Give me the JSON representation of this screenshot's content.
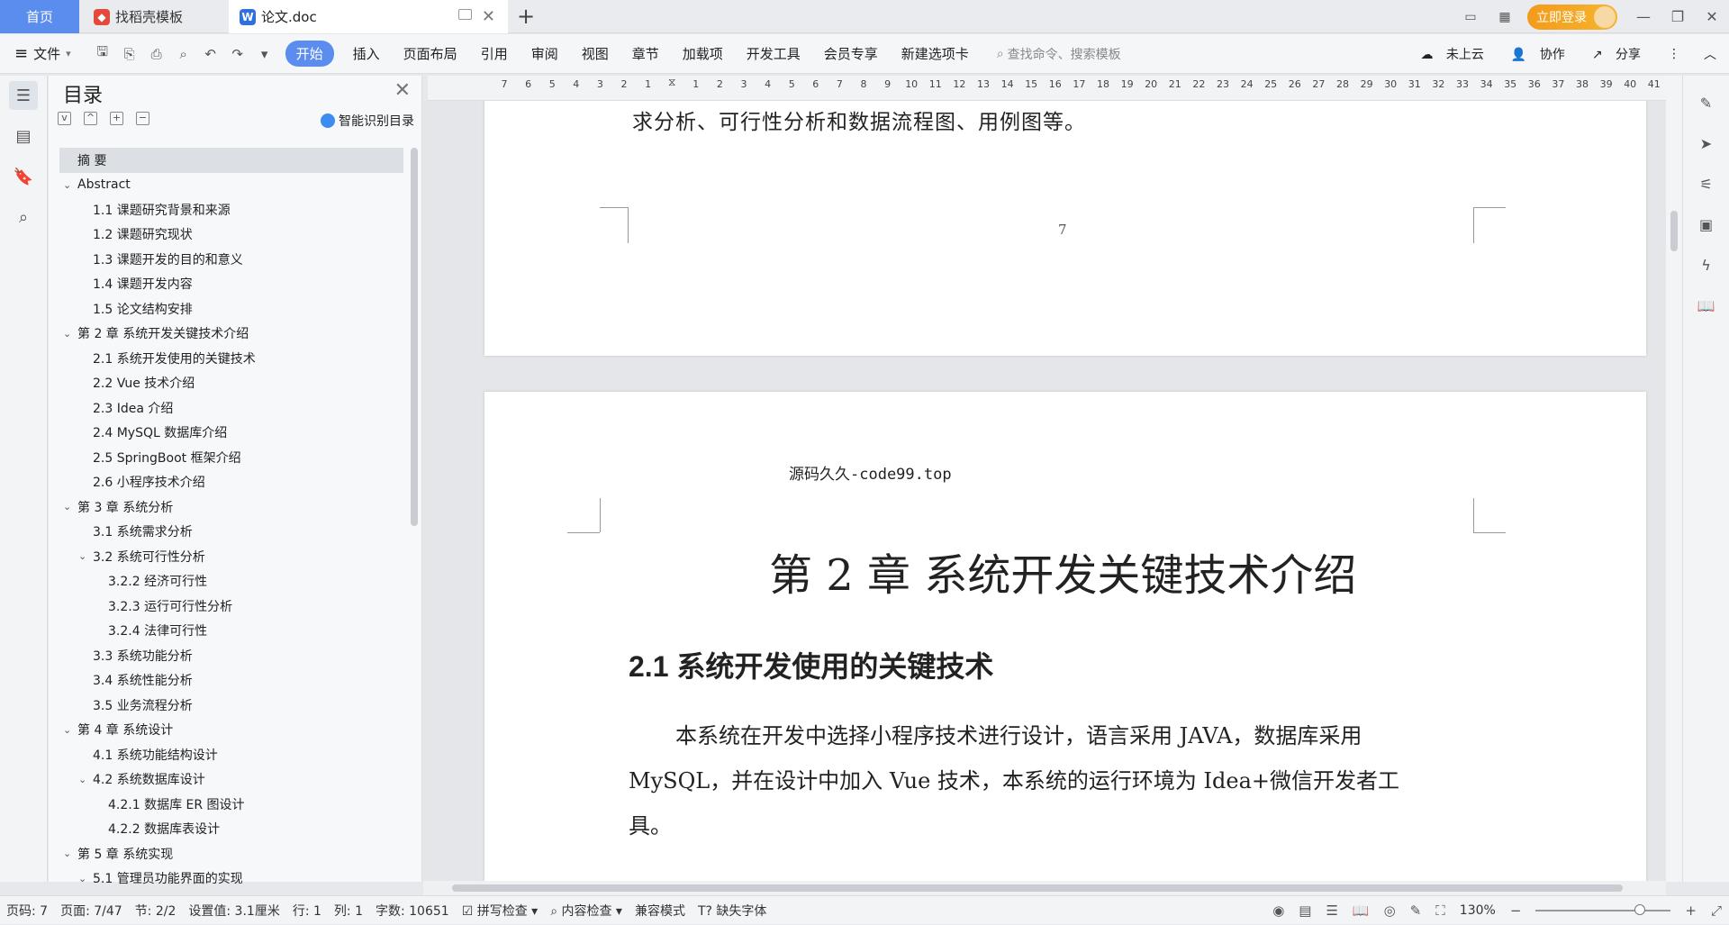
{
  "tabs": {
    "home": "首页",
    "template": "找稻壳模板",
    "doc": "论文.doc",
    "login": "立即登录"
  },
  "toolbar": {
    "file": "文件",
    "ribbon": [
      "开始",
      "插入",
      "页面布局",
      "引用",
      "审阅",
      "视图",
      "章节",
      "加载项",
      "开发工具",
      "会员专享",
      "新建选项卡"
    ],
    "search_placeholder": "查找命令、搜索模板",
    "cloud": "未上云",
    "collab": "协作",
    "share": "分享"
  },
  "ruler": [
    "7",
    "6",
    "5",
    "4",
    "3",
    "2",
    "1",
    "",
    "1",
    "2",
    "3",
    "4",
    "5",
    "6",
    "7",
    "8",
    "9",
    "10",
    "11",
    "12",
    "13",
    "14",
    "15",
    "16",
    "17",
    "18",
    "19",
    "20",
    "21",
    "22",
    "23",
    "24",
    "25",
    "26",
    "27",
    "28",
    "29",
    "30",
    "31",
    "32",
    "33",
    "34",
    "35",
    "36",
    "37",
    "38",
    "39",
    "40",
    "41"
  ],
  "toc": {
    "title": "目录",
    "smart": "智能识别目录",
    "items": [
      {
        "text": "摘 要",
        "level": 0,
        "arrow": "",
        "selected": true
      },
      {
        "text": "Abstract",
        "level": 0,
        "arrow": "v"
      },
      {
        "text": "1.1 课题研究背景和来源",
        "level": 1,
        "arrow": ""
      },
      {
        "text": "1.2 课题研究现状",
        "level": 1,
        "arrow": ""
      },
      {
        "text": "1.3 课题开发的目的和意义",
        "level": 1,
        "arrow": ""
      },
      {
        "text": "1.4 课题开发内容",
        "level": 1,
        "arrow": ""
      },
      {
        "text": "1.5 论文结构安排",
        "level": 1,
        "arrow": ""
      },
      {
        "text": "第 2 章  系统开发关键技术介绍",
        "level": 0,
        "arrow": "v"
      },
      {
        "text": "2.1 系统开发使用的关键技术",
        "level": 1,
        "arrow": ""
      },
      {
        "text": "2.2 Vue 技术介绍",
        "level": 1,
        "arrow": ""
      },
      {
        "text": "2.3 Idea 介绍",
        "level": 1,
        "arrow": ""
      },
      {
        "text": "2.4 MySQL 数据库介绍",
        "level": 1,
        "arrow": ""
      },
      {
        "text": "2.5 SpringBoot 框架介绍",
        "level": 1,
        "arrow": ""
      },
      {
        "text": "2.6 小程序技术介绍",
        "level": 1,
        "arrow": ""
      },
      {
        "text": "第 3 章  系统分析",
        "level": 0,
        "arrow": "v"
      },
      {
        "text": "3.1 系统需求分析",
        "level": 1,
        "arrow": ""
      },
      {
        "text": "3.2 系统可行性分析",
        "level": 1,
        "arrow": "v"
      },
      {
        "text": "3.2.2 经济可行性",
        "level": 2,
        "arrow": ""
      },
      {
        "text": "3.2.3 运行可行性分析",
        "level": 2,
        "arrow": ""
      },
      {
        "text": "3.2.4 法律可行性",
        "level": 2,
        "arrow": ""
      },
      {
        "text": "3.3 系统功能分析",
        "level": 1,
        "arrow": ""
      },
      {
        "text": "3.4 系统性能分析",
        "level": 1,
        "arrow": ""
      },
      {
        "text": "3.5 业务流程分析",
        "level": 1,
        "arrow": ""
      },
      {
        "text": "第 4 章  系统设计",
        "level": 0,
        "arrow": "v"
      },
      {
        "text": "4.1 系统功能结构设计",
        "level": 1,
        "arrow": ""
      },
      {
        "text": "4.2 系统数据库设计",
        "level": 1,
        "arrow": "v"
      },
      {
        "text": "4.2.1 数据库 ER 图设计",
        "level": 2,
        "arrow": ""
      },
      {
        "text": "4.2.2 数据库表设计",
        "level": 2,
        "arrow": ""
      },
      {
        "text": "第 5 章  系统实现",
        "level": 0,
        "arrow": "v"
      },
      {
        "text": "5.1 管理员功能界面的实现",
        "level": 1,
        "arrow": "v"
      }
    ]
  },
  "doc": {
    "page1_tail": "求分析、可行性分析和数据流程图、用例图等。",
    "page_number": "7",
    "header_text": "源码久久-code99.top",
    "chapter_title": "第 2 章  系统开发关键技术介绍",
    "section_title": "2.1 系统开发使用的关键技术",
    "para_line1": "本系统在开发中选择小程序技术进行设计，语言采用 JAVA，数据库采用",
    "para_line2": "MySQL，并在设计中加入 Vue 技术，本系统的运行环境为 Idea+微信开发者工",
    "para_line3": "具。"
  },
  "status": {
    "page_code": "页码: 7",
    "page": "页面: 7/47",
    "section": "节: 2/2",
    "setting": "设置值: 3.1厘米",
    "row": "行: 1",
    "col": "列: 1",
    "words": "字数: 10651",
    "spell": "拼写检查",
    "content": "内容检查",
    "compat": "兼容模式",
    "missing_font": "缺失字体",
    "zoom": "130%"
  }
}
